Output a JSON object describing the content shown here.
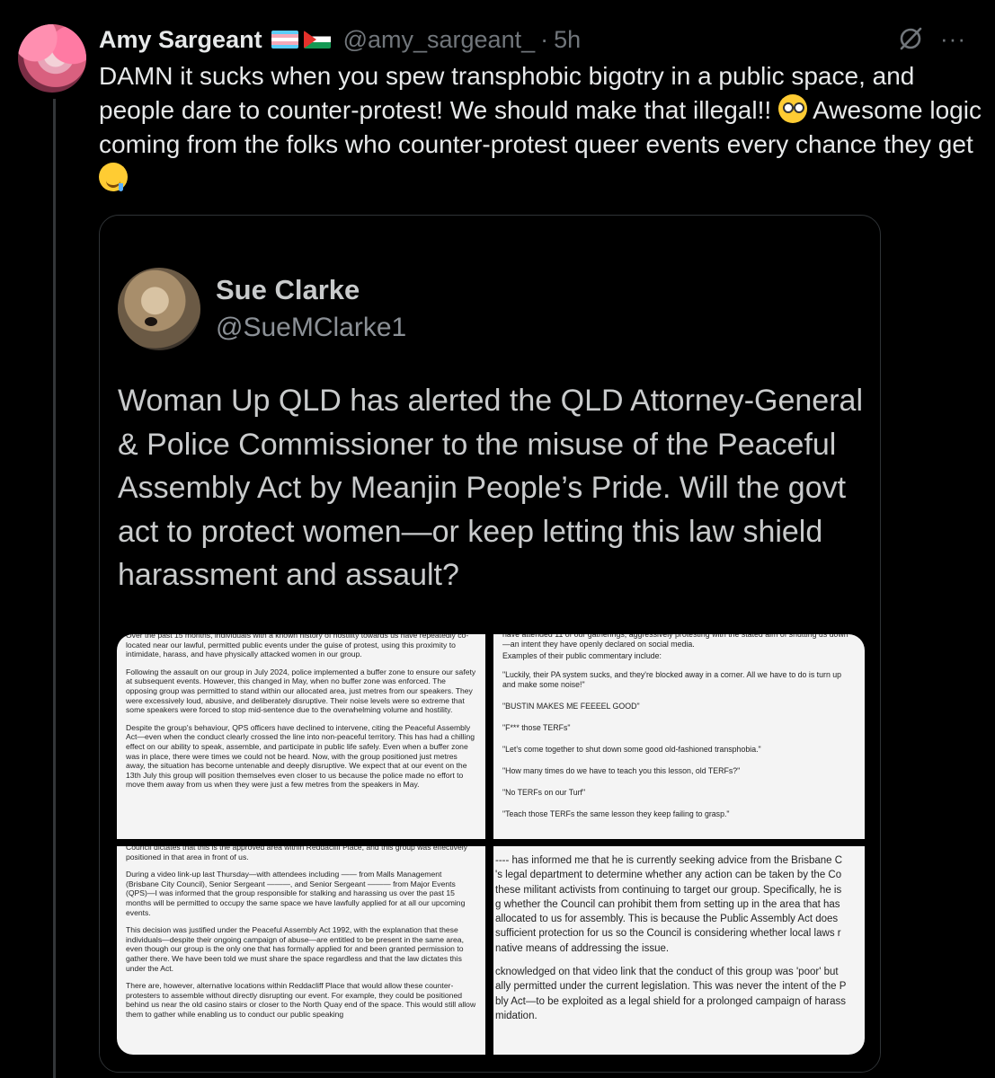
{
  "post": {
    "author_name": "Amy Sargeant",
    "handle": "@amy_sargeant_",
    "separator": "·",
    "time": "5h",
    "more": "···",
    "text_1": "DAMN it sucks when you spew transphobic bigotry in a public space, and people dare to counter-protest! We should make that illegal!!",
    "text_2": "Awesome logic coming from the folks who counter-protest queer events every chance they get",
    "icons": {
      "grok": "grok-icon",
      "more": "more-icon",
      "flag1": "transgender-flag-icon",
      "flag2": "palestine-flag-icon",
      "emoji1": "nerd-face-emoji",
      "emoji2": "drooling-face-emoji"
    }
  },
  "quoted": {
    "author_name": "Sue Clarke",
    "handle": "@SueMClarke1",
    "text": "Woman Up QLD has alerted the QLD Attorney-General & Police Commissioner to the misuse of the Peaceful Assembly Act by Meanjin People’s Pride. Will the govt act to protect women—or keep letting this law shield harassment and assault?",
    "doc_top_left": [
      "Over the past 15 months, individuals with a known history of hostility towards us have repeatedly co-located near our lawful, permitted public events under the guise of protest, using this proximity to intimidate, harass, and have physically attacked women in our group.",
      "Following the assault on our group in July 2024, police implemented a buffer zone to ensure our safety at subsequent events. However, this changed in May, when no buffer zone was enforced. The opposing group was permitted to stand within our allocated area, just metres from our speakers. They were excessively loud, abusive, and deliberately disruptive. Their noise levels were so extreme that some speakers were forced to stop mid-sentence due to the overwhelming volume and hostility.",
      "Despite the group's behaviour, QPS officers have declined to intervene, citing the Peaceful Assembly Act—even when the conduct clearly crossed the line into non-peaceful territory. This has had a chilling effect on our ability to speak, assemble, and participate in public life safely. Even when a buffer zone was in place, there were times we could not be heard. Now, with the group positioned just metres away, the situation has become untenable and deeply disruptive. We expect that at our event on the 13th July this group will position themselves even closer to us because the police made no effort to move them away from us when they were just a few metres from the speakers in May."
    ],
    "doc_top_right": [
      "have attended 11 of our gatherings, aggressively protesting with the stated aim of shutting us down—an intent they have openly declared on social media.",
      "Examples of their public commentary include:",
      "\"Luckily, their PA system sucks, and they're blocked away in a corner. All we have to do is turn up and make some noise!\"",
      "\"BUSTIN MAKES ME FEEEEL GOOD\"",
      "\"F*** those TERFs\"",
      "\"Let's come together to shut down some good old-fashioned transphobia.\"",
      "\"How many times do we have to teach you this lesson, old TERFs?\"",
      "\"No TERFs on our Turf\"",
      "\"Teach those TERFs the same lesson they keep failing to grasp.\""
    ],
    "doc_bottom_left": [
      "Council dictates that this is the approved area within Reddacliff Place, and this group was effectively positioned in that area in front of us.",
      "During a video link-up last Thursday—with attendees including —— from Malls Management (Brisbane City Council), Senior Sergeant ———, and Senior Sergeant ——— from Major Events (QPS)—I was informed that the group responsible for stalking and harassing us over the past 15 months will be permitted to occupy the same space we have lawfully applied for at all our upcoming events.",
      "This decision was justified under the Peaceful Assembly Act 1992, with the explanation that these individuals—despite their ongoing campaign of abuse—are entitled to be present in the same area, even though our group is the only one that has formally applied for and been granted permission to gather there. We have been told we must share the space regardless and that the law dictates this under the Act.",
      "There are, however, alternative locations within Reddacliff Place that would allow these counter-protesters to assemble without directly disrupting our event. For example, they could be positioned behind us near the old casino stairs or closer to the North Quay end of the space. This would still allow them to gather while enabling us to conduct our public speaking"
    ],
    "doc_bottom_right": [
      "---- has informed me that he is currently seeking advice from the Brisbane C",
      "'s legal department to determine whether any action can be taken by the Co",
      " these militant activists from continuing to target our group. Specifically, he is",
      "g whether the Council can prohibit them from setting up in the area that has",
      " allocated to us for assembly. This is because the Public Assembly Act does",
      " sufficient protection for us so the Council is considering whether local laws r",
      "native means of addressing the issue.",
      "",
      "cknowledged on that video link that the conduct of this group was 'poor' but",
      "ally permitted under the current legislation. This was never the intent of the P",
      "bly Act—to be exploited as a legal shield for a prolonged campaign of harass",
      "midation."
    ]
  }
}
